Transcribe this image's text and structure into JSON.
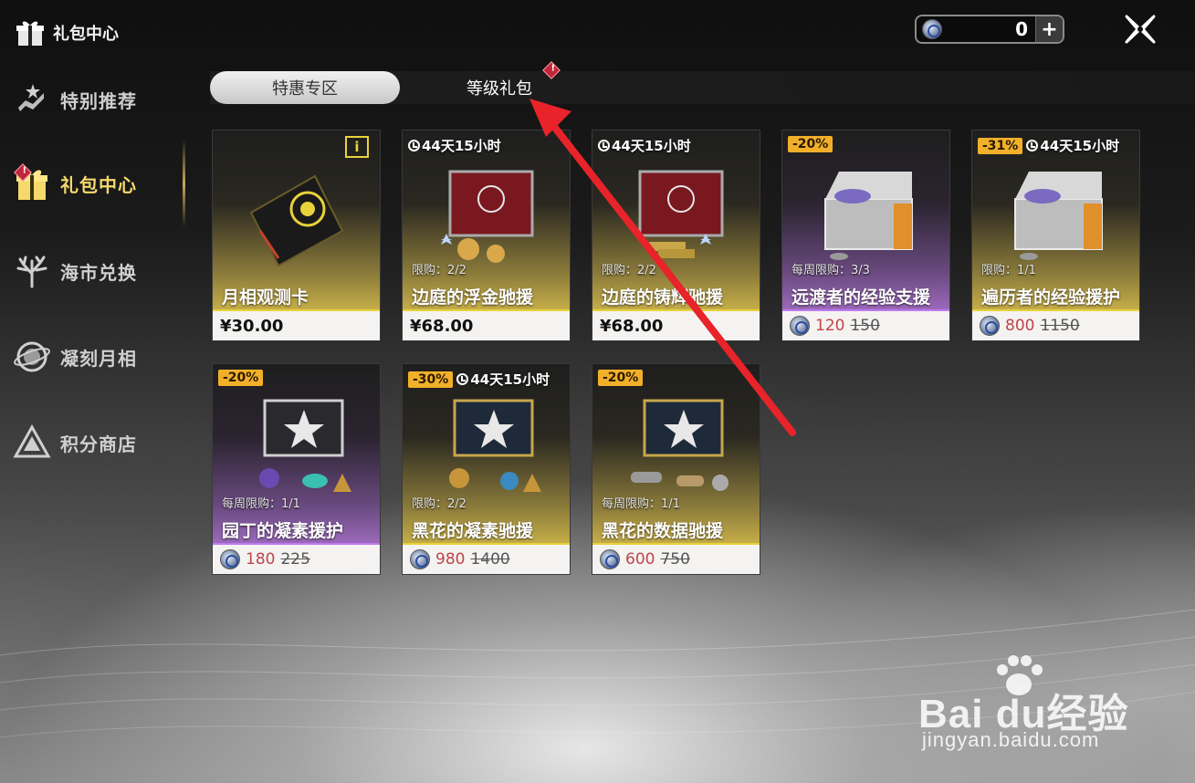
{
  "header": {
    "title": "礼包中心",
    "currency_value": "0",
    "plus_label": "+"
  },
  "sidebar": {
    "items": [
      {
        "label": "特别推荐",
        "icon": "hand-star-icon"
      },
      {
        "label": "礼包中心",
        "icon": "gift-box-icon",
        "active": true
      },
      {
        "label": "海市兑换",
        "icon": "coral-tree-icon"
      },
      {
        "label": "凝刻月相",
        "icon": "moon-orb-icon"
      },
      {
        "label": "积分商店",
        "icon": "triangle-emblem-icon"
      }
    ]
  },
  "tabs": [
    {
      "label": "特惠专区",
      "selected": true
    },
    {
      "label": "等级礼包",
      "selected": false,
      "alert": "!"
    }
  ],
  "cards": [
    {
      "name": "月相观测卡",
      "price": "¥30.00",
      "info": "i",
      "theme": "gold"
    },
    {
      "name": "边庭的浮金驰援",
      "price": "¥68.00",
      "timer": "44天15小时",
      "limit": "限购：2/2",
      "theme": "gold"
    },
    {
      "name": "边庭的铸辉驰援",
      "price": "¥68.00",
      "timer": "44天15小时",
      "limit": "限购：2/2",
      "theme": "gold"
    },
    {
      "name": "远渡者的经验支援",
      "price_new": "120",
      "price_old": "150",
      "discount": "-20%",
      "limit": "每周限购：3/3",
      "theme": "purple"
    },
    {
      "name": "遍历者的经验援护",
      "price_new": "800",
      "price_old": "1150",
      "discount": "-31%",
      "timer": "44天15小时",
      "limit": "限购：1/1",
      "theme": "gold"
    },
    {
      "name": "园丁的凝素援护",
      "price_new": "180",
      "price_old": "225",
      "discount": "-20%",
      "limit": "每周限购：1/1",
      "theme": "purple"
    },
    {
      "name": "黑花的凝素驰援",
      "price_new": "980",
      "price_old": "1400",
      "discount": "-30%",
      "timer": "44天15小时",
      "limit": "限购：2/2",
      "theme": "gold"
    },
    {
      "name": "黑花的数据驰援",
      "price_new": "600",
      "price_old": "750",
      "discount": "-20%",
      "limit": "每周限购：1/1",
      "theme": "gold"
    }
  ],
  "watermark": {
    "main": "Bai du经验",
    "sub": "jingyan.baidu.com"
  },
  "colors": {
    "accent_gold": "#e8d23a",
    "accent_purple": "#c079f0",
    "discount_badge": "#f2b02a",
    "sale_price": "#c0444a",
    "annotation_arrow": "#e8232a"
  }
}
